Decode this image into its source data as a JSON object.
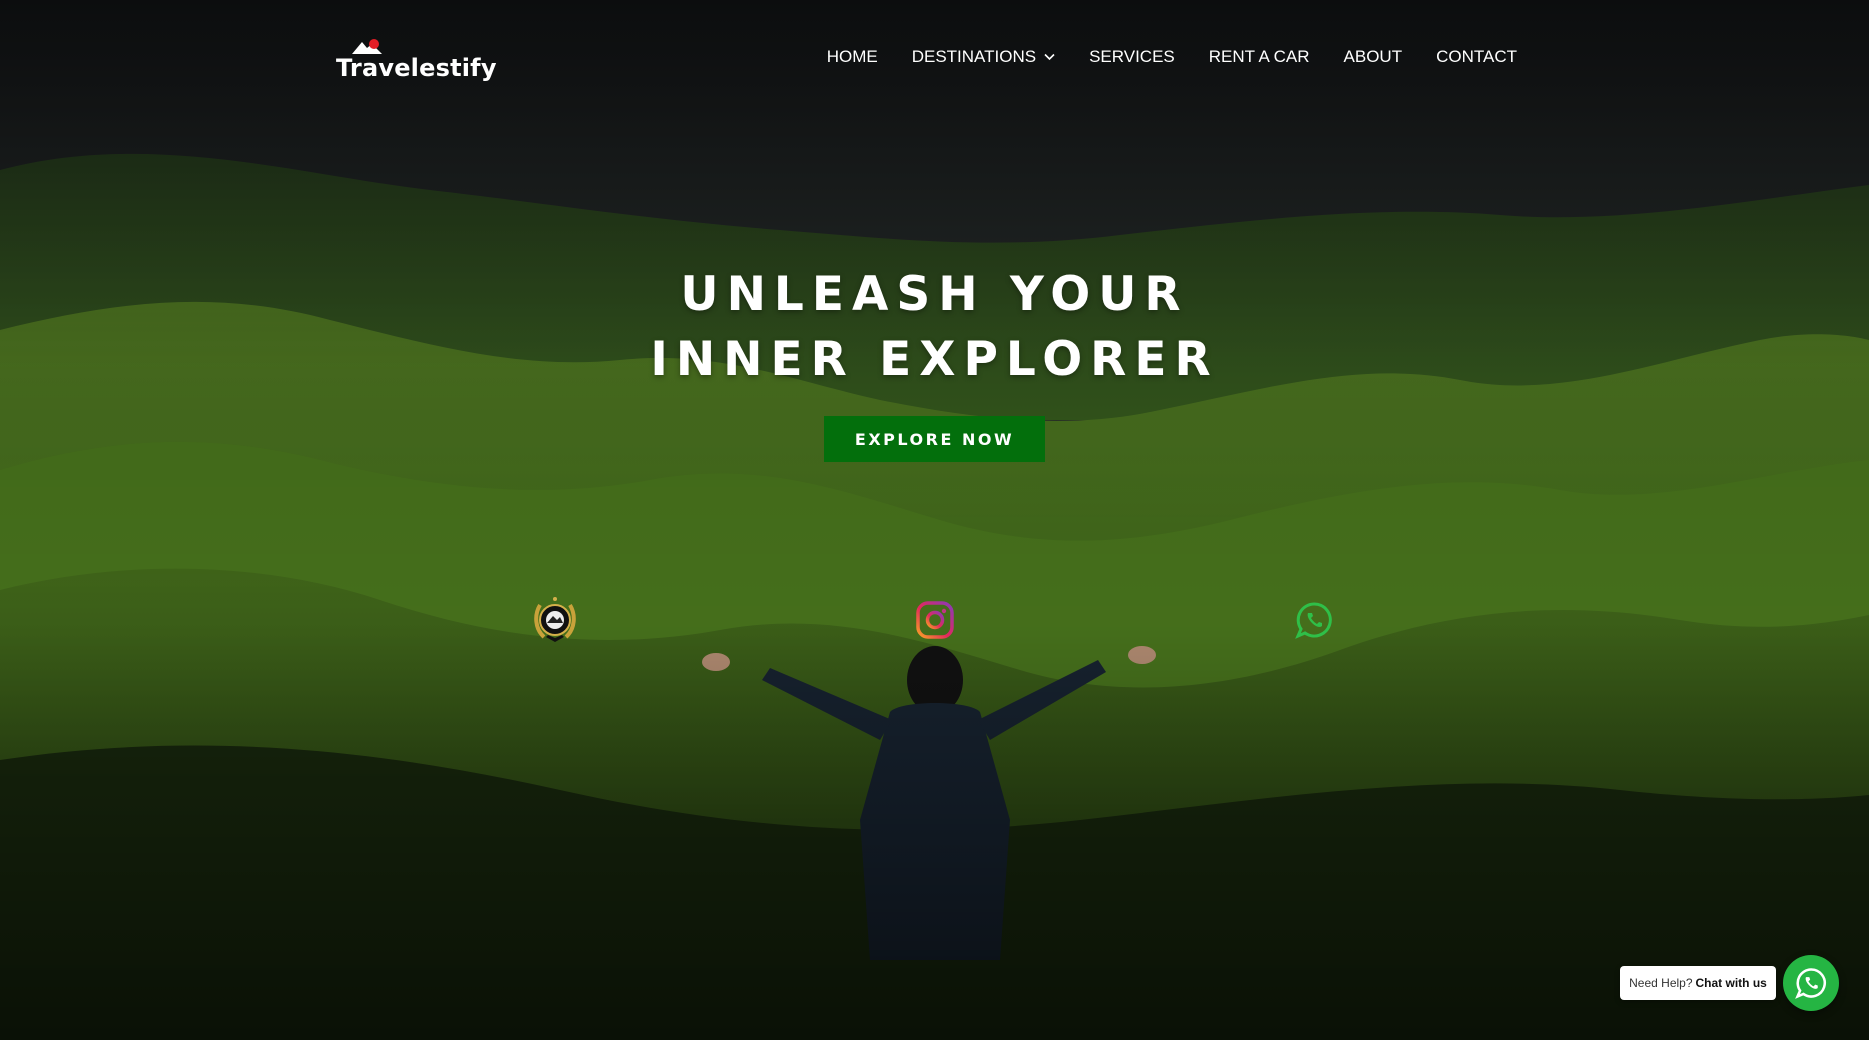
{
  "brand": {
    "logo_text": "Travelestify"
  },
  "nav": {
    "items": [
      {
        "label": "HOME"
      },
      {
        "label": "DESTINATIONS",
        "has_dropdown": true
      },
      {
        "label": "SERVICES"
      },
      {
        "label": "RENT A CAR"
      },
      {
        "label": "ABOUT"
      },
      {
        "label": "CONTACT"
      }
    ]
  },
  "hero": {
    "headline_line1": "UNLEASH YOUR",
    "headline_line2": "INNER EXPLORER",
    "cta_label": "EXPLORE NOW"
  },
  "social": {
    "icons": [
      "award-badge-icon",
      "instagram-icon",
      "whatsapp-icon"
    ]
  },
  "chat": {
    "prefix": "Need Help?",
    "action": "Chat with us"
  },
  "colors": {
    "cta_green": "#036f0c",
    "whatsapp_green": "#25b543",
    "text": "#ffffff"
  }
}
